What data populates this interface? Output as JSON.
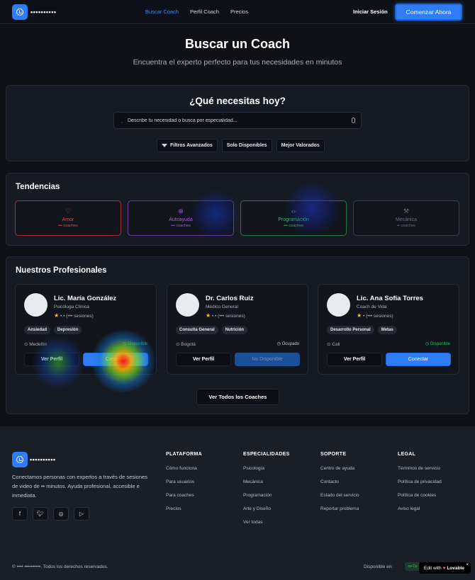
{
  "nav": {
    "brand": "••••••••••",
    "links": [
      "Buscar Coach",
      "Perfil Coach",
      "Precios"
    ],
    "login": "Iniciar Sesión",
    "cta": "Comenzar Ahora"
  },
  "hero": {
    "title": "Buscar un Coach",
    "subtitle": "Encuentra el experto perfecto para tus necesidades en minutos"
  },
  "search": {
    "title": "¿Qué necesitas hoy?",
    "placeholder": "Describe tu necesidad o busca por especialidad...",
    "filters": [
      "Filtros Avanzados",
      "Solo Disponibles",
      "Mejor Valorados"
    ]
  },
  "trends": {
    "title": "Tendencias",
    "items": [
      {
        "icon": "heart-icon",
        "glyph": "♡",
        "label": "Amor",
        "count": "••• coaches",
        "color": "#e5484d",
        "border": "#a8323a"
      },
      {
        "icon": "self-help-icon",
        "glyph": "⊕",
        "label": "Autoayuda",
        "count": "••• coaches",
        "color": "#a855f7",
        "border": "#6d3aa3"
      },
      {
        "icon": "code-icon",
        "glyph": "‹›",
        "label": "Programación",
        "count": "••• coaches",
        "color": "#22c55e",
        "border": "#1f7a44"
      },
      {
        "icon": "wrench-icon",
        "glyph": "⚒",
        "label": "Mecánica",
        "count": "•• coaches",
        "color": "#6b7080",
        "border": "#393e4a"
      }
    ]
  },
  "professionals": {
    "title": "Nuestros Profesionales",
    "cards": [
      {
        "name": "Lic. María González",
        "role": "Psicóloga Clínica",
        "rating": "•.•",
        "sessions": "(••• sesiones)",
        "tags": [
          "Ansiedad",
          "Depresión"
        ],
        "location": "Medellín",
        "status": "Disponible",
        "status_color": "#22c55e",
        "profile_btn": "Ver Perfil",
        "connect_btn": "Conectar",
        "connect_disabled": false
      },
      {
        "name": "Dr. Carlos Ruiz",
        "role": "Médico General",
        "rating": "•.•",
        "sessions": "(••• sesiones)",
        "tags": [
          "Consulta General",
          "Nutrición"
        ],
        "location": "Bogotá",
        "status": "Ocupado",
        "status_color": "#c5c9d3",
        "profile_btn": "Ver Perfil",
        "connect_btn": "No Disponible",
        "connect_disabled": true
      },
      {
        "name": "Lic. Ana Sofía Torres",
        "role": "Coach de Vida",
        "rating": "•",
        "sessions": "(••• sesiones)",
        "tags": [
          "Desarrollo Personal",
          "Metas"
        ],
        "location": "Cali",
        "status": "Disponible",
        "status_color": "#22c55e",
        "profile_btn": "Ver Perfil",
        "connect_btn": "Conectar",
        "connect_disabled": false
      }
    ],
    "view_all": "Ver Todos los Coaches"
  },
  "footer": {
    "brand": "••••••••••",
    "description": "Conectamos personas con expertos a través de sesiones de video de •• minutos. Ayuda profesional, accesible e inmediata.",
    "socials": [
      "facebook-icon",
      "twitter-icon",
      "instagram-icon",
      "youtube-icon"
    ],
    "columns": [
      {
        "title": "PLATAFORMA",
        "links": [
          "Cómo funciona",
          "Para usuarios",
          "Para coaches",
          "Precios"
        ]
      },
      {
        "title": "ESPECIALIDADES",
        "links": [
          "Psicología",
          "Mecánica",
          "Programación",
          "Arte y Diseño",
          "Ver todas"
        ]
      },
      {
        "title": "SOPORTE",
        "links": [
          "Centro de ayuda",
          "Contacto",
          "Estado del servicio",
          "Reportar problema"
        ]
      },
      {
        "title": "LEGAL",
        "links": [
          "Términos de servicio",
          "Política de privacidad",
          "Política de cookies",
          "Aviso legal"
        ]
      }
    ],
    "copyright": "© •••• ••••••••••. Todos los derechos reservados.",
    "available_on": "Disponible en:",
    "available_badge": "co Co"
  },
  "lovable": {
    "edit": "Edit with",
    "brand": "Lovable",
    "close": "×"
  }
}
